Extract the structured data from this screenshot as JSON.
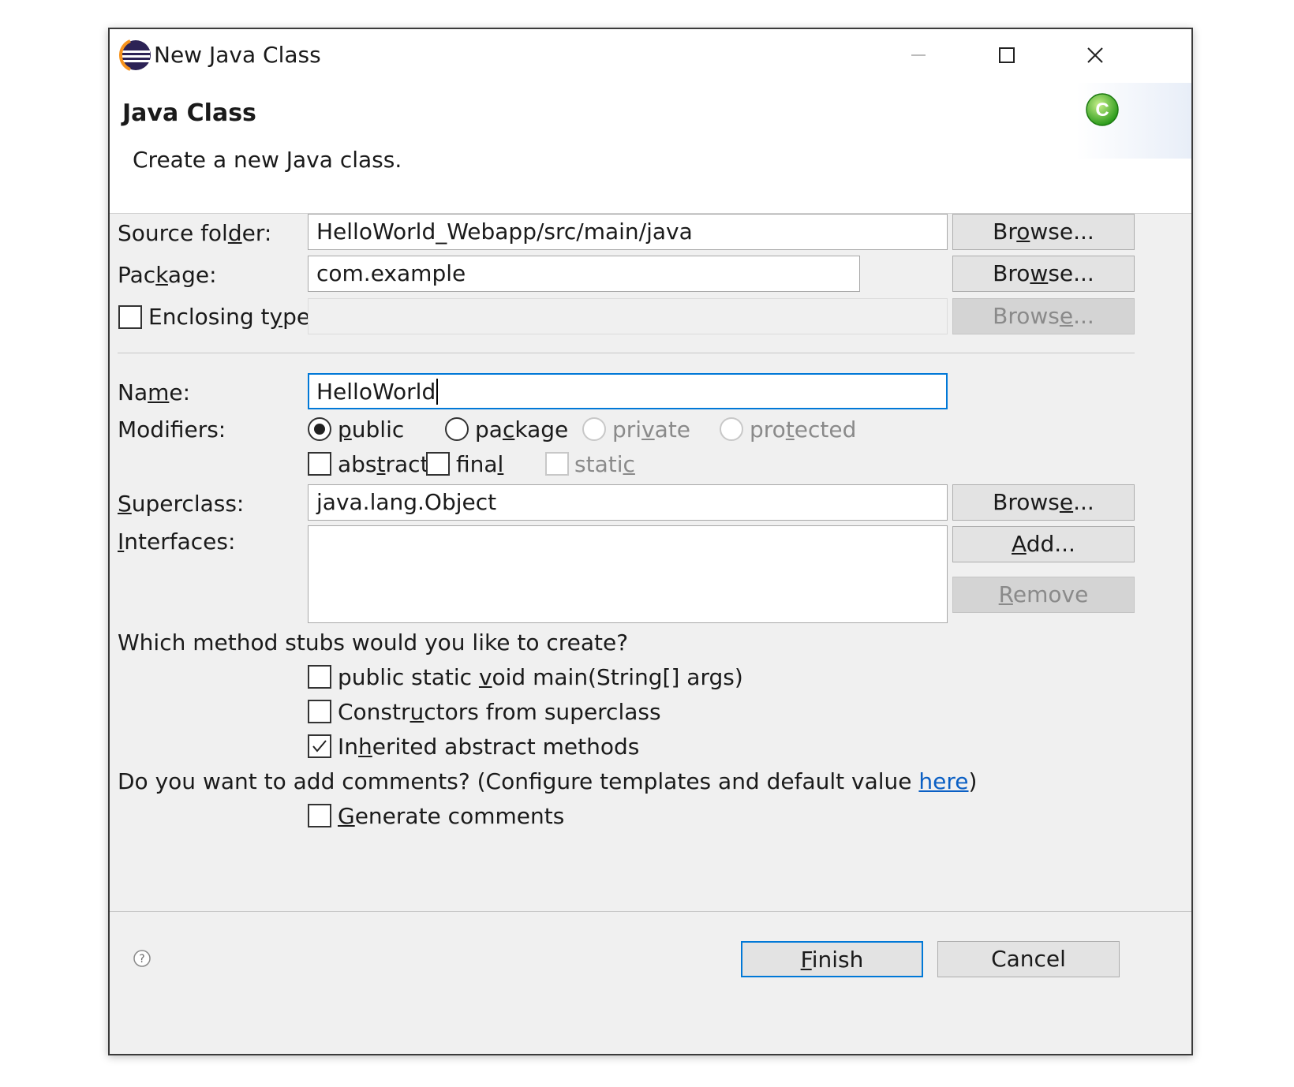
{
  "window": {
    "title": "New Java Class",
    "icon": "eclipse-icon",
    "controls": {
      "minimize": "minimize-icon",
      "maximize": "maximize-icon",
      "close": "close-icon"
    }
  },
  "header": {
    "title": "Java Class",
    "description": "Create a new Java class.",
    "icon": "new-class-icon"
  },
  "form": {
    "source_folder": {
      "label": "Source folder:",
      "value": "HelloWorld_Webapp/src/main/java",
      "browse": "Browse..."
    },
    "package": {
      "label": "Package:",
      "value": "com.example",
      "browse": "Browse..."
    },
    "enclosing_type": {
      "label": "Enclosing type:",
      "value": "",
      "browse": "Browse...",
      "checked": false
    },
    "name": {
      "label": "Name:",
      "value": "HelloWorld"
    },
    "modifiers": {
      "label": "Modifiers:",
      "radios": [
        {
          "label": "public",
          "selected": true,
          "enabled": true
        },
        {
          "label": "package",
          "selected": false,
          "enabled": true
        },
        {
          "label": "private",
          "selected": false,
          "enabled": false
        },
        {
          "label": "protected",
          "selected": false,
          "enabled": false
        }
      ],
      "checks": [
        {
          "label": "abstract",
          "checked": false,
          "enabled": true
        },
        {
          "label": "final",
          "checked": false,
          "enabled": true
        },
        {
          "label": "static",
          "checked": false,
          "enabled": false
        }
      ]
    },
    "superclass": {
      "label": "Superclass:",
      "value": "java.lang.Object",
      "browse": "Browse..."
    },
    "interfaces": {
      "label": "Interfaces:",
      "items": [],
      "add": "Add...",
      "remove": "Remove"
    },
    "stubs": {
      "question": "Which method stubs would you like to create?",
      "options": [
        {
          "label": "public static void main(String[] args)",
          "checked": false
        },
        {
          "label": "Constructors from superclass",
          "checked": false
        },
        {
          "label": "Inherited abstract methods",
          "checked": true
        }
      ]
    },
    "comments": {
      "question_prefix": "Do you want to add comments? (Configure templates and default value ",
      "link": "here",
      "question_suffix": ")",
      "option": {
        "label": "Generate comments",
        "checked": false
      }
    }
  },
  "footer": {
    "help_icon": "help-icon",
    "finish": "Finish",
    "cancel": "Cancel"
  },
  "colors": {
    "dialog_bg": "#f0f0f0",
    "header_bg": "#ffffff",
    "link": "#0a5fc4",
    "focus_border": "#0078d7"
  }
}
